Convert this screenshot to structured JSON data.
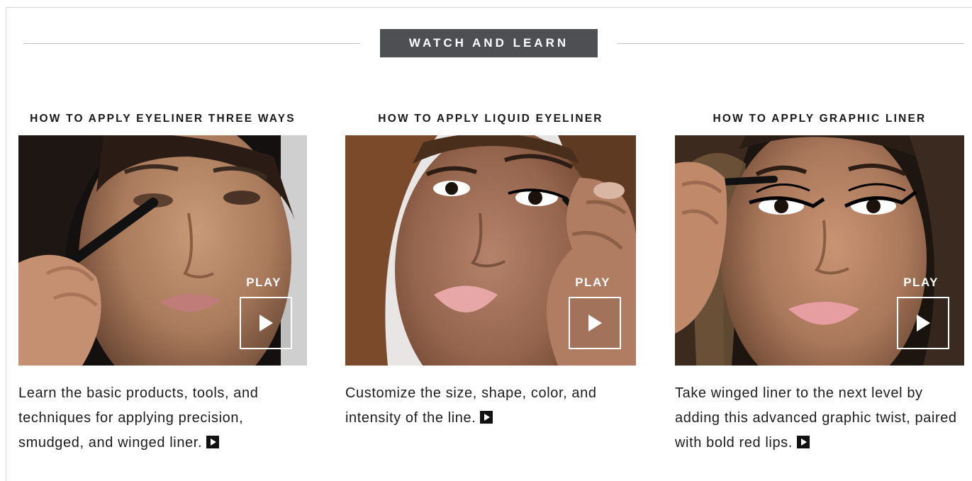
{
  "section": {
    "heading": "WATCH AND LEARN"
  },
  "videos": [
    {
      "title": "HOW TO APPLY EYELINER THREE WAYS",
      "play_label": "PLAY",
      "description": "Learn the basic products, tools, and techniques for applying precision, smudged, and winged liner.",
      "thumbnail_icon": "video-thumbnail-eyeliner-three-ways"
    },
    {
      "title": "HOW TO APPLY LIQUID EYELINER",
      "play_label": "PLAY",
      "description": "Customize the size, shape, color, and intensity of the line.",
      "thumbnail_icon": "video-thumbnail-liquid-eyeliner"
    },
    {
      "title": "HOW TO APPLY GRAPHIC LINER",
      "play_label": "PLAY",
      "description": "Take winged liner to the next level by adding this advanced graphic twist, paired with bold red lips.",
      "thumbnail_icon": "video-thumbnail-graphic-liner"
    }
  ],
  "colors": {
    "banner_bg": "#4d4f53",
    "banner_text": "#ffffff",
    "rule": "#bdbdbd",
    "text": "#1c1c1c"
  }
}
